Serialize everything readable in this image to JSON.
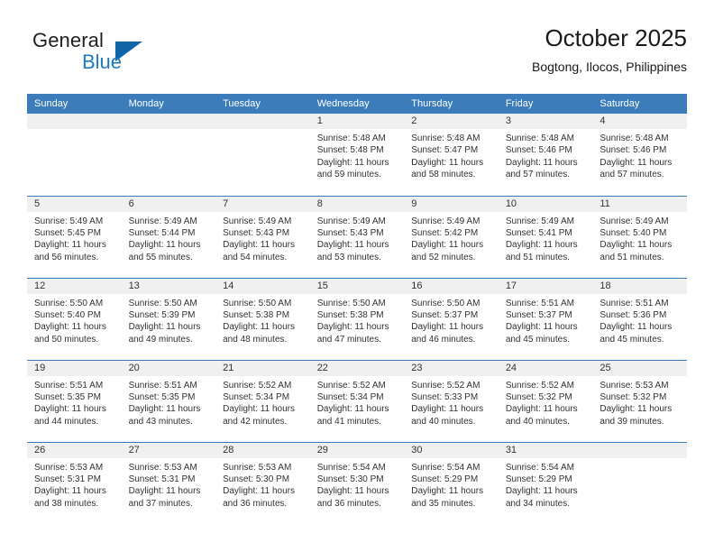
{
  "brand": {
    "name_part1": "General",
    "name_part2": "Blue",
    "logo_icon": "triangle-logo-icon"
  },
  "header": {
    "title": "October 2025",
    "subtitle": "Bogtong, Ilocos, Philippines"
  },
  "calendar": {
    "weekday_headers": [
      "Sunday",
      "Monday",
      "Tuesday",
      "Wednesday",
      "Thursday",
      "Friday",
      "Saturday"
    ],
    "colors": {
      "header_blue": "#3c7cba",
      "daynum_band": "#f0f0f0",
      "brand_blue": "#1a7bc4",
      "brand_dark_blue": "#1064a8",
      "text": "#333333"
    },
    "labels": {
      "sunrise": "Sunrise:",
      "sunset": "Sunset:",
      "daylight": "Daylight:"
    },
    "weeks": [
      [
        {
          "day": "",
          "empty": true
        },
        {
          "day": "",
          "empty": true
        },
        {
          "day": "",
          "empty": true
        },
        {
          "day": "1",
          "sunrise": "Sunrise: 5:48 AM",
          "sunset": "Sunset: 5:48 PM",
          "daylight1": "Daylight: 11 hours",
          "daylight2": "and 59 minutes."
        },
        {
          "day": "2",
          "sunrise": "Sunrise: 5:48 AM",
          "sunset": "Sunset: 5:47 PM",
          "daylight1": "Daylight: 11 hours",
          "daylight2": "and 58 minutes."
        },
        {
          "day": "3",
          "sunrise": "Sunrise: 5:48 AM",
          "sunset": "Sunset: 5:46 PM",
          "daylight1": "Daylight: 11 hours",
          "daylight2": "and 57 minutes."
        },
        {
          "day": "4",
          "sunrise": "Sunrise: 5:48 AM",
          "sunset": "Sunset: 5:46 PM",
          "daylight1": "Daylight: 11 hours",
          "daylight2": "and 57 minutes."
        }
      ],
      [
        {
          "day": "5",
          "sunrise": "Sunrise: 5:49 AM",
          "sunset": "Sunset: 5:45 PM",
          "daylight1": "Daylight: 11 hours",
          "daylight2": "and 56 minutes."
        },
        {
          "day": "6",
          "sunrise": "Sunrise: 5:49 AM",
          "sunset": "Sunset: 5:44 PM",
          "daylight1": "Daylight: 11 hours",
          "daylight2": "and 55 minutes."
        },
        {
          "day": "7",
          "sunrise": "Sunrise: 5:49 AM",
          "sunset": "Sunset: 5:43 PM",
          "daylight1": "Daylight: 11 hours",
          "daylight2": "and 54 minutes."
        },
        {
          "day": "8",
          "sunrise": "Sunrise: 5:49 AM",
          "sunset": "Sunset: 5:43 PM",
          "daylight1": "Daylight: 11 hours",
          "daylight2": "and 53 minutes."
        },
        {
          "day": "9",
          "sunrise": "Sunrise: 5:49 AM",
          "sunset": "Sunset: 5:42 PM",
          "daylight1": "Daylight: 11 hours",
          "daylight2": "and 52 minutes."
        },
        {
          "day": "10",
          "sunrise": "Sunrise: 5:49 AM",
          "sunset": "Sunset: 5:41 PM",
          "daylight1": "Daylight: 11 hours",
          "daylight2": "and 51 minutes."
        },
        {
          "day": "11",
          "sunrise": "Sunrise: 5:49 AM",
          "sunset": "Sunset: 5:40 PM",
          "daylight1": "Daylight: 11 hours",
          "daylight2": "and 51 minutes."
        }
      ],
      [
        {
          "day": "12",
          "sunrise": "Sunrise: 5:50 AM",
          "sunset": "Sunset: 5:40 PM",
          "daylight1": "Daylight: 11 hours",
          "daylight2": "and 50 minutes."
        },
        {
          "day": "13",
          "sunrise": "Sunrise: 5:50 AM",
          "sunset": "Sunset: 5:39 PM",
          "daylight1": "Daylight: 11 hours",
          "daylight2": "and 49 minutes."
        },
        {
          "day": "14",
          "sunrise": "Sunrise: 5:50 AM",
          "sunset": "Sunset: 5:38 PM",
          "daylight1": "Daylight: 11 hours",
          "daylight2": "and 48 minutes."
        },
        {
          "day": "15",
          "sunrise": "Sunrise: 5:50 AM",
          "sunset": "Sunset: 5:38 PM",
          "daylight1": "Daylight: 11 hours",
          "daylight2": "and 47 minutes."
        },
        {
          "day": "16",
          "sunrise": "Sunrise: 5:50 AM",
          "sunset": "Sunset: 5:37 PM",
          "daylight1": "Daylight: 11 hours",
          "daylight2": "and 46 minutes."
        },
        {
          "day": "17",
          "sunrise": "Sunrise: 5:51 AM",
          "sunset": "Sunset: 5:37 PM",
          "daylight1": "Daylight: 11 hours",
          "daylight2": "and 45 minutes."
        },
        {
          "day": "18",
          "sunrise": "Sunrise: 5:51 AM",
          "sunset": "Sunset: 5:36 PM",
          "daylight1": "Daylight: 11 hours",
          "daylight2": "and 45 minutes."
        }
      ],
      [
        {
          "day": "19",
          "sunrise": "Sunrise: 5:51 AM",
          "sunset": "Sunset: 5:35 PM",
          "daylight1": "Daylight: 11 hours",
          "daylight2": "and 44 minutes."
        },
        {
          "day": "20",
          "sunrise": "Sunrise: 5:51 AM",
          "sunset": "Sunset: 5:35 PM",
          "daylight1": "Daylight: 11 hours",
          "daylight2": "and 43 minutes."
        },
        {
          "day": "21",
          "sunrise": "Sunrise: 5:52 AM",
          "sunset": "Sunset: 5:34 PM",
          "daylight1": "Daylight: 11 hours",
          "daylight2": "and 42 minutes."
        },
        {
          "day": "22",
          "sunrise": "Sunrise: 5:52 AM",
          "sunset": "Sunset: 5:34 PM",
          "daylight1": "Daylight: 11 hours",
          "daylight2": "and 41 minutes."
        },
        {
          "day": "23",
          "sunrise": "Sunrise: 5:52 AM",
          "sunset": "Sunset: 5:33 PM",
          "daylight1": "Daylight: 11 hours",
          "daylight2": "and 40 minutes."
        },
        {
          "day": "24",
          "sunrise": "Sunrise: 5:52 AM",
          "sunset": "Sunset: 5:32 PM",
          "daylight1": "Daylight: 11 hours",
          "daylight2": "and 40 minutes."
        },
        {
          "day": "25",
          "sunrise": "Sunrise: 5:53 AM",
          "sunset": "Sunset: 5:32 PM",
          "daylight1": "Daylight: 11 hours",
          "daylight2": "and 39 minutes."
        }
      ],
      [
        {
          "day": "26",
          "sunrise": "Sunrise: 5:53 AM",
          "sunset": "Sunset: 5:31 PM",
          "daylight1": "Daylight: 11 hours",
          "daylight2": "and 38 minutes."
        },
        {
          "day": "27",
          "sunrise": "Sunrise: 5:53 AM",
          "sunset": "Sunset: 5:31 PM",
          "daylight1": "Daylight: 11 hours",
          "daylight2": "and 37 minutes."
        },
        {
          "day": "28",
          "sunrise": "Sunrise: 5:53 AM",
          "sunset": "Sunset: 5:30 PM",
          "daylight1": "Daylight: 11 hours",
          "daylight2": "and 36 minutes."
        },
        {
          "day": "29",
          "sunrise": "Sunrise: 5:54 AM",
          "sunset": "Sunset: 5:30 PM",
          "daylight1": "Daylight: 11 hours",
          "daylight2": "and 36 minutes."
        },
        {
          "day": "30",
          "sunrise": "Sunrise: 5:54 AM",
          "sunset": "Sunset: 5:29 PM",
          "daylight1": "Daylight: 11 hours",
          "daylight2": "and 35 minutes."
        },
        {
          "day": "31",
          "sunrise": "Sunrise: 5:54 AM",
          "sunset": "Sunset: 5:29 PM",
          "daylight1": "Daylight: 11 hours",
          "daylight2": "and 34 minutes."
        },
        {
          "day": "",
          "empty": true
        }
      ]
    ]
  }
}
